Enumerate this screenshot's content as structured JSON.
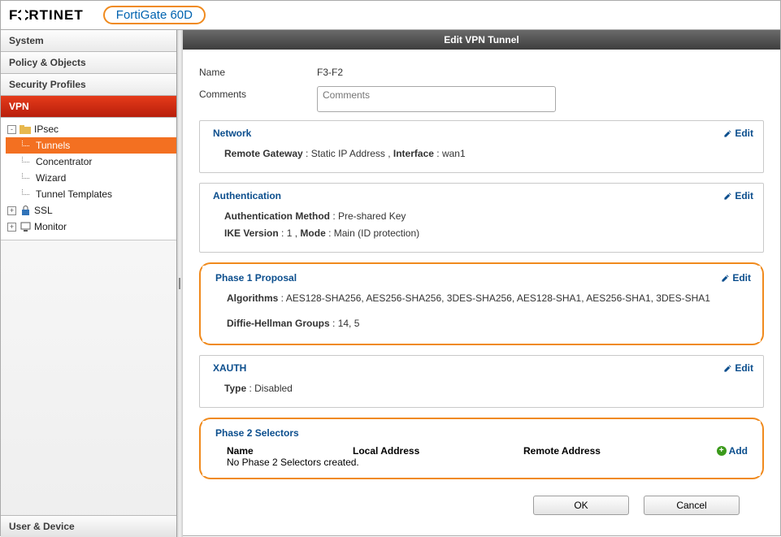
{
  "header": {
    "logo_text": "FORTINET",
    "device_name": "FortiGate 60D"
  },
  "sidebar": {
    "sections": {
      "system": "System",
      "policy": "Policy & Objects",
      "security": "Security Profiles",
      "vpn": "VPN",
      "user": "User & Device"
    },
    "tree": {
      "ipsec": "IPsec",
      "tunnels": "Tunnels",
      "concentrator": "Concentrator",
      "wizard": "Wizard",
      "tunnel_templates": "Tunnel Templates",
      "ssl": "SSL",
      "monitor": "Monitor"
    }
  },
  "main": {
    "title": "Edit VPN Tunnel",
    "name_label": "Name",
    "name_value": "F3-F2",
    "comments_label": "Comments",
    "comments_placeholder": "Comments",
    "edit_label": "Edit",
    "add_label": "Add",
    "network": {
      "title": "Network",
      "rg_label": "Remote Gateway",
      "rg_value": "Static IP Address ,",
      "iface_label": "Interface",
      "iface_value": "wan1"
    },
    "auth": {
      "title": "Authentication",
      "method_label": "Authentication Method",
      "method_value": "Pre-shared Key",
      "ike_label": "IKE Version",
      "ike_value": "1 ,",
      "mode_label": "Mode",
      "mode_value": "Main (ID protection)"
    },
    "p1": {
      "title": "Phase 1 Proposal",
      "algo_label": "Algorithms",
      "algo_value": "AES128-SHA256, AES256-SHA256, 3DES-SHA256, AES128-SHA1, AES256-SHA1, 3DES-SHA1",
      "dh_label": "Diffie-Hellman Groups",
      "dh_value": "14, 5"
    },
    "xauth": {
      "title": "XAUTH",
      "type_label": "Type",
      "type_value": "Disabled"
    },
    "p2": {
      "title": "Phase 2 Selectors",
      "col_name": "Name",
      "col_local": "Local Address",
      "col_remote": "Remote Address",
      "empty": "No Phase 2 Selectors created."
    },
    "buttons": {
      "ok": "OK",
      "cancel": "Cancel"
    }
  }
}
